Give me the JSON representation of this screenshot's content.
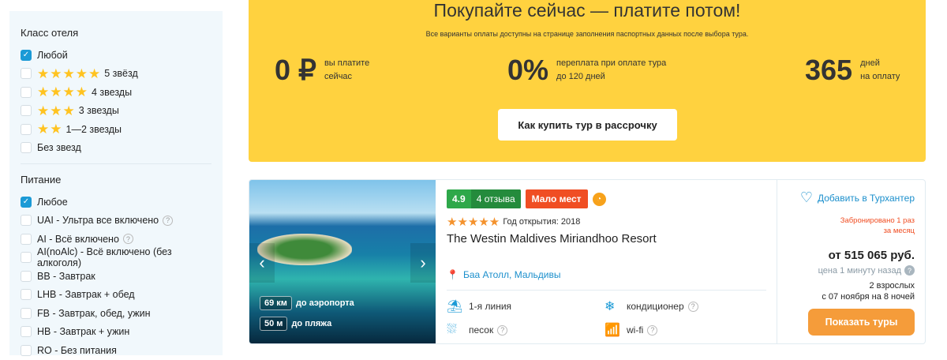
{
  "sidebar": {
    "hotel_class": {
      "title": "Класс отеля",
      "items": [
        {
          "label": "Любой",
          "checked": true,
          "stars": 0
        },
        {
          "label": "5 звёзд",
          "checked": false,
          "stars": 5
        },
        {
          "label": "4 звезды",
          "checked": false,
          "stars": 4
        },
        {
          "label": "3 звезды",
          "checked": false,
          "stars": 3
        },
        {
          "label": "1—2 звезды",
          "checked": false,
          "stars": 2
        },
        {
          "label": "Без звезд",
          "checked": false,
          "stars": 0
        }
      ]
    },
    "meals": {
      "title": "Питание",
      "items": [
        {
          "label": "Любое",
          "checked": true,
          "help": false
        },
        {
          "label": "UAI - Ультра все включено",
          "checked": false,
          "help": true
        },
        {
          "label": "AI - Всё включено",
          "checked": false,
          "help": true
        },
        {
          "label": "AI(noAlc) - Всё включено (без алкоголя)",
          "checked": false,
          "help": false
        },
        {
          "label": "BB - Завтрак",
          "checked": false,
          "help": false
        },
        {
          "label": "LHB - Завтрак + обед",
          "checked": false,
          "help": false
        },
        {
          "label": "FB - Завтрак, обед, ужин",
          "checked": false,
          "help": false
        },
        {
          "label": "HB - Завтрак + ужин",
          "checked": false,
          "help": false
        },
        {
          "label": "RO - Без питания",
          "checked": false,
          "help": false
        }
      ]
    }
  },
  "banner": {
    "title": "Покупайте сейчас — платите потом!",
    "subtitle": "Все варианты оплаты доступны на странице заполнения паспортных данных после выбора тура.",
    "stats": [
      {
        "value": "0 ₽",
        "line1": "вы платите",
        "line2": "сейчас"
      },
      {
        "value": "0%",
        "line1": "переплата при оплате тура",
        "line2": "до 120 дней"
      },
      {
        "value": "365",
        "line1": "дней",
        "line2": "на оплату"
      }
    ],
    "button": "Как купить тур в рассрочку",
    "color": "#ffd23f"
  },
  "hotel": {
    "rating": "4.9",
    "reviews": "4 отзыва",
    "badge": "Мало мест",
    "stars": 5,
    "opened": "Год открытия: 2018",
    "name": "The Westin Maldives Miriandhoo Resort",
    "location": "Баа Атолл, Мальдивы",
    "distances": [
      {
        "value": "69 км",
        "label": "до аэропорта"
      },
      {
        "value": "50 м",
        "label": "до пляжа"
      }
    ],
    "amenities": [
      {
        "icon": "beach-line-icon",
        "label": "1-я линия",
        "help": false
      },
      {
        "icon": "air-conditioner-icon",
        "label": "кондиционер",
        "help": true
      },
      {
        "icon": "sand-icon",
        "label": "песок",
        "help": true
      },
      {
        "icon": "wifi-icon",
        "label": "wi-fi",
        "help": true
      }
    ],
    "favorite": "Добавить в Турхантер",
    "booked_line1": "Забронировано 1 раз",
    "booked_line2": "за месяц",
    "price": "от 515 065 руб.",
    "price_age": "цена 1 минуту назад",
    "pax": "2 взрослых",
    "dates": "с 07 ноября на 8 ночей",
    "show_button": "Показать туры"
  }
}
